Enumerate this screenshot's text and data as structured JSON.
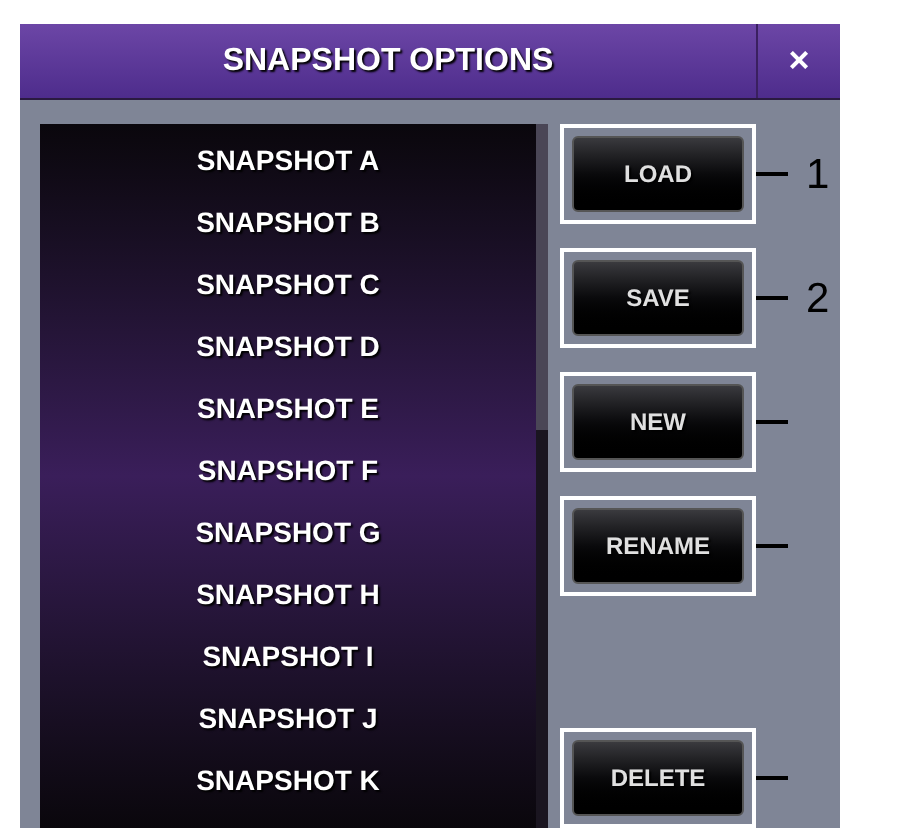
{
  "window": {
    "title": "SNAPSHOT OPTIONS",
    "close": "×"
  },
  "snapshots": [
    "SNAPSHOT A",
    "SNAPSHOT B",
    "SNAPSHOT C",
    "SNAPSHOT D",
    "SNAPSHOT E",
    "SNAPSHOT F",
    "SNAPSHOT G",
    "SNAPSHOT H",
    "SNAPSHOT I",
    "SNAPSHOT J",
    "SNAPSHOT K"
  ],
  "buttons": [
    {
      "label": "LOAD",
      "callout": "1"
    },
    {
      "label": "SAVE",
      "callout": "2"
    },
    {
      "label": "NEW"
    },
    {
      "label": "RENAME"
    }
  ],
  "bottom_buttons": [
    {
      "label": "DELETE"
    }
  ]
}
